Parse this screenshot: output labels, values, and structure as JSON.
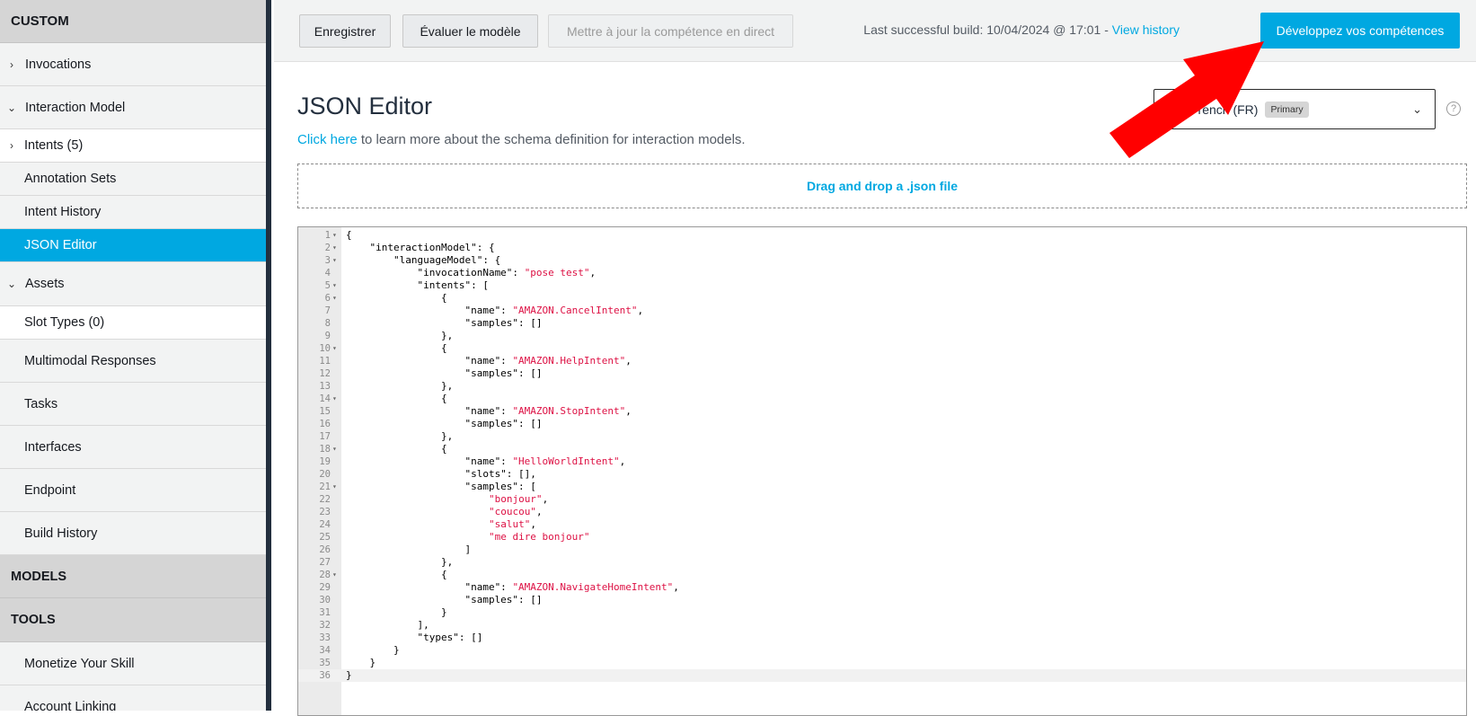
{
  "sidebar": {
    "header": "CUSTOM",
    "items": [
      {
        "label": "Invocations",
        "chevron": "›"
      },
      {
        "label": "Interaction Model",
        "chevron": "⌄"
      },
      {
        "label": "Intents (5)",
        "chevron": "›"
      },
      {
        "label": "Annotation Sets"
      },
      {
        "label": "Intent History"
      },
      {
        "label": "JSON Editor"
      },
      {
        "label": "Assets",
        "chevron": "⌄"
      },
      {
        "label": "Slot Types (0)"
      },
      {
        "label": "Multimodal Responses"
      },
      {
        "label": "Tasks"
      },
      {
        "label": "Interfaces"
      },
      {
        "label": "Endpoint"
      },
      {
        "label": "Build History"
      }
    ],
    "section_models": "MODELS",
    "section_tools": "TOOLS",
    "tools_items": [
      {
        "label": "Monetize Your Skill"
      },
      {
        "label": "Account Linking"
      }
    ]
  },
  "toolbar": {
    "save_label": "Enregistrer",
    "evaluate_label": "Évaluer le modèle",
    "live_update_label": "Mettre à jour la compétence en direct",
    "build_status": "Last successful build: 10/04/2024 @ 17:01 -",
    "view_history": "View history",
    "build_button": "Développez vos compétences"
  },
  "main": {
    "title": "JSON Editor",
    "subtitle_link": "Click here",
    "subtitle_rest": " to learn more about the schema definition for interaction models.",
    "language": "French (FR)",
    "language_badge": "Primary",
    "help_icon": "?",
    "dropzone": "Drag and drop a .json file"
  },
  "editor": {
    "active_line": 36,
    "lines": [
      {
        "n": "1",
        "fold": true,
        "code": "{"
      },
      {
        "n": "2",
        "fold": true,
        "code": "    \"interactionModel\": {"
      },
      {
        "n": "3",
        "fold": true,
        "code": "        \"languageModel\": {"
      },
      {
        "n": "4",
        "fold": false,
        "code": "            \"invocationName\": ",
        "str": "\"pose test\"",
        "tail": ","
      },
      {
        "n": "5",
        "fold": true,
        "code": "            \"intents\": ["
      },
      {
        "n": "6",
        "fold": true,
        "code": "                {"
      },
      {
        "n": "7",
        "fold": false,
        "code": "                    \"name\": ",
        "str": "\"AMAZON.CancelIntent\"",
        "tail": ","
      },
      {
        "n": "8",
        "fold": false,
        "code": "                    \"samples\": []"
      },
      {
        "n": "9",
        "fold": false,
        "code": "                },"
      },
      {
        "n": "10",
        "fold": true,
        "code": "                {"
      },
      {
        "n": "11",
        "fold": false,
        "code": "                    \"name\": ",
        "str": "\"AMAZON.HelpIntent\"",
        "tail": ","
      },
      {
        "n": "12",
        "fold": false,
        "code": "                    \"samples\": []"
      },
      {
        "n": "13",
        "fold": false,
        "code": "                },"
      },
      {
        "n": "14",
        "fold": true,
        "code": "                {"
      },
      {
        "n": "15",
        "fold": false,
        "code": "                    \"name\": ",
        "str": "\"AMAZON.StopIntent\"",
        "tail": ","
      },
      {
        "n": "16",
        "fold": false,
        "code": "                    \"samples\": []"
      },
      {
        "n": "17",
        "fold": false,
        "code": "                },"
      },
      {
        "n": "18",
        "fold": true,
        "code": "                {"
      },
      {
        "n": "19",
        "fold": false,
        "code": "                    \"name\": ",
        "str": "\"HelloWorldIntent\"",
        "tail": ","
      },
      {
        "n": "20",
        "fold": false,
        "code": "                    \"slots\": [],"
      },
      {
        "n": "21",
        "fold": true,
        "code": "                    \"samples\": ["
      },
      {
        "n": "22",
        "fold": false,
        "code": "                        ",
        "str": "\"bonjour\"",
        "tail": ","
      },
      {
        "n": "23",
        "fold": false,
        "code": "                        ",
        "str": "\"coucou\"",
        "tail": ","
      },
      {
        "n": "24",
        "fold": false,
        "code": "                        ",
        "str": "\"salut\"",
        "tail": ","
      },
      {
        "n": "25",
        "fold": false,
        "code": "                        ",
        "str": "\"me dire bonjour\"",
        "tail": ""
      },
      {
        "n": "26",
        "fold": false,
        "code": "                    ]"
      },
      {
        "n": "27",
        "fold": false,
        "code": "                },"
      },
      {
        "n": "28",
        "fold": true,
        "code": "                {"
      },
      {
        "n": "29",
        "fold": false,
        "code": "                    \"name\": ",
        "str": "\"AMAZON.NavigateHomeIntent\"",
        "tail": ","
      },
      {
        "n": "30",
        "fold": false,
        "code": "                    \"samples\": []"
      },
      {
        "n": "31",
        "fold": false,
        "code": "                }"
      },
      {
        "n": "32",
        "fold": false,
        "code": "            ],"
      },
      {
        "n": "33",
        "fold": false,
        "code": "            \"types\": []"
      },
      {
        "n": "34",
        "fold": false,
        "code": "        }"
      },
      {
        "n": "35",
        "fold": false,
        "code": "    }"
      },
      {
        "n": "36",
        "fold": false,
        "code": "}"
      }
    ]
  },
  "colors": {
    "accent": "#00a8e1",
    "arrow": "#ff0000",
    "sidebar_selected": "#00a8e1",
    "string": "#dd1144"
  }
}
